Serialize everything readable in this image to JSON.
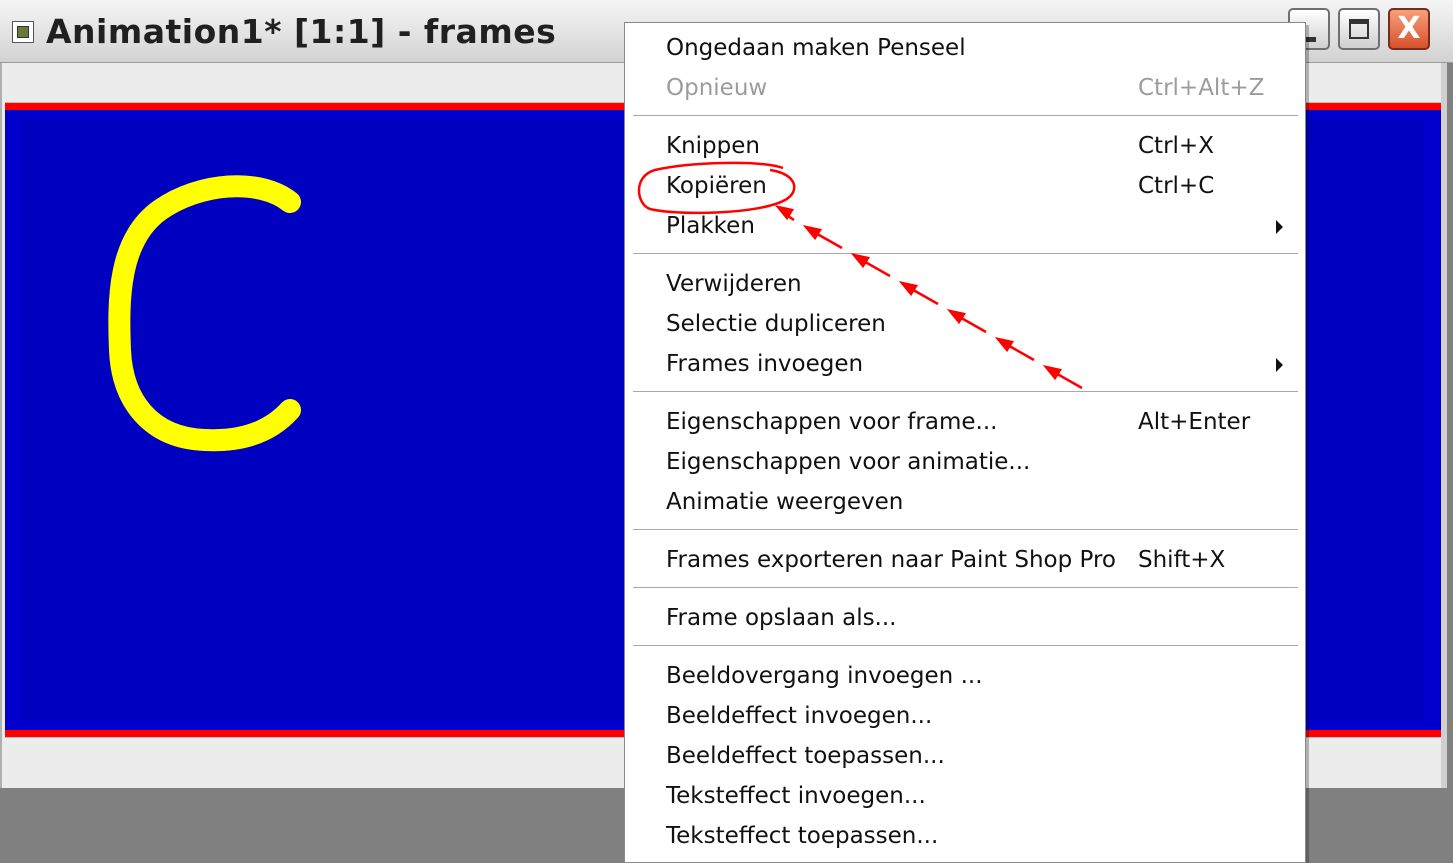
{
  "window": {
    "title": "Animation1* [1:1] - frames",
    "app_icon": "animation-shop-icon",
    "controls": {
      "minimize_icon": "minimize-icon",
      "maximize_icon": "maximize-icon",
      "close_icon": "close-icon",
      "close_glyph": "X"
    }
  },
  "canvas": {
    "background": "#0000cc",
    "border_color": "#ff0000",
    "letter_color": "#ffff00",
    "letter": "C"
  },
  "context_menu": {
    "items": [
      {
        "label": "Ongedaan maken Penseel",
        "shortcut": "",
        "disabled": false,
        "submenu": false
      },
      {
        "label": "Opnieuw",
        "shortcut": "Ctrl+Alt+Z",
        "disabled": true,
        "submenu": false
      },
      {
        "label": "Knippen",
        "shortcut": "Ctrl+X",
        "disabled": false,
        "submenu": false
      },
      {
        "label": "Kopiëren",
        "shortcut": "Ctrl+C",
        "disabled": false,
        "submenu": false
      },
      {
        "label": "Plakken",
        "shortcut": "",
        "disabled": false,
        "submenu": true
      },
      {
        "label": "Verwijderen",
        "shortcut": "",
        "disabled": false,
        "submenu": false
      },
      {
        "label": "Selectie dupliceren",
        "shortcut": "",
        "disabled": false,
        "submenu": false
      },
      {
        "label": "Frames invoegen",
        "shortcut": "",
        "disabled": false,
        "submenu": true
      },
      {
        "label": "Eigenschappen voor frame...",
        "shortcut": "Alt+Enter",
        "disabled": false,
        "submenu": false
      },
      {
        "label": "Eigenschappen voor animatie...",
        "shortcut": "",
        "disabled": false,
        "submenu": false
      },
      {
        "label": "Animatie weergeven",
        "shortcut": "",
        "disabled": false,
        "submenu": false
      },
      {
        "label": "Frames exporteren naar Paint Shop Pro",
        "shortcut": "Shift+X",
        "disabled": false,
        "submenu": false
      },
      {
        "label": "Frame opslaan als...",
        "shortcut": "",
        "disabled": false,
        "submenu": false
      },
      {
        "label": "Beeldovergang invoegen ...",
        "shortcut": "",
        "disabled": false,
        "submenu": false
      },
      {
        "label": "Beeldeffect invoegen...",
        "shortcut": "",
        "disabled": false,
        "submenu": false
      },
      {
        "label": "Beeldeffect toepassen...",
        "shortcut": "",
        "disabled": false,
        "submenu": false
      },
      {
        "label": "Teksteffect invoegen...",
        "shortcut": "",
        "disabled": false,
        "submenu": false
      },
      {
        "label": "Teksteffect toepassen...",
        "shortcut": "",
        "disabled": false,
        "submenu": false
      }
    ],
    "highlighted_item": "Kopiëren",
    "annotation_color": "#ff0000"
  }
}
